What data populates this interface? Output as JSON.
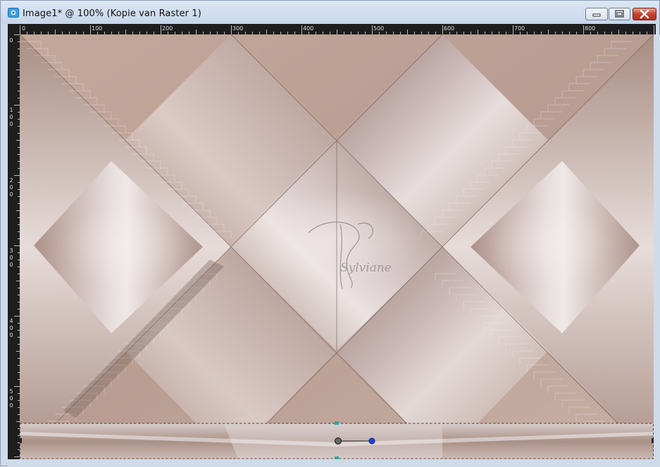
{
  "window": {
    "title": "Image1* @ 100% (Kopie van Raster 1)"
  },
  "ruler_horizontal": {
    "labels": [
      "0",
      "100",
      "200",
      "300",
      "400",
      "500",
      "600",
      "700",
      "800"
    ]
  },
  "ruler_vertical": {
    "labels": [
      [
        "0"
      ],
      [
        "1",
        "0",
        "0"
      ],
      [
        "2",
        "0",
        "0"
      ],
      [
        "3",
        "0",
        "0"
      ],
      [
        "4",
        "0",
        "0"
      ],
      [
        "5",
        "0",
        "0"
      ]
    ]
  },
  "watermark": {
    "text": "Sylviane"
  },
  "colors": {
    "canvas_base": "#c7ab9f",
    "canvas_light": "#efe6e6",
    "canvas_dark": "#9c8277",
    "ruler_bg": "#1e1e1e",
    "ruler_text": "#dddddd",
    "selection_handle": "#2ea8a0",
    "pick_handle": "#2244dd"
  }
}
